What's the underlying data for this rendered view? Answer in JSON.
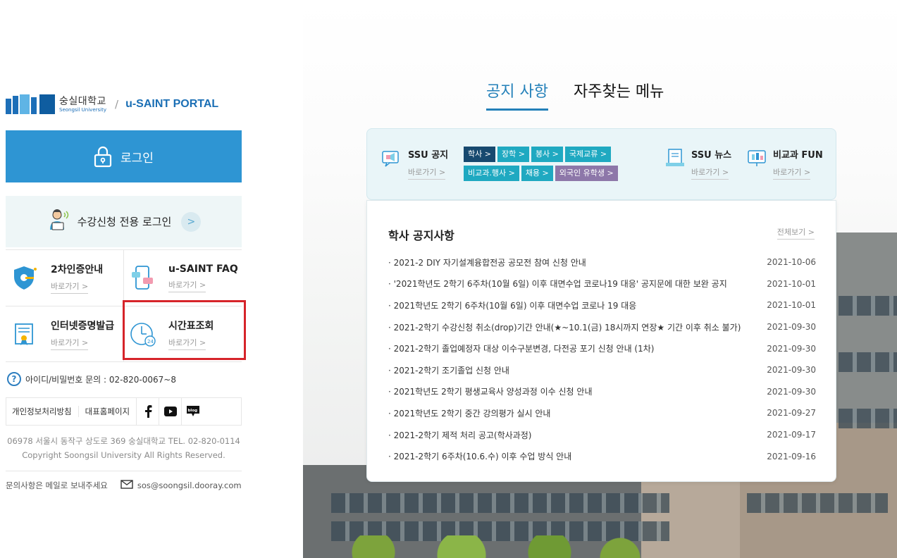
{
  "brand": {
    "logo_ko": "숭실대학교",
    "logo_en": "Seongsil University",
    "separator": "/",
    "portal": "u-SAINT PORTAL"
  },
  "login": {
    "label": "로그인"
  },
  "course_login": {
    "label": "수강신청 전용 로그인",
    "arrow": ">"
  },
  "tiles": [
    {
      "title": "2차인증안내",
      "go": "바로가기 >"
    },
    {
      "title": "u-SAINT FAQ",
      "go": "바로가기 >"
    },
    {
      "title": "인터넷증명발급",
      "go": "바로가기 >"
    },
    {
      "title": "시간표조회",
      "go": "바로가기 >"
    }
  ],
  "inquiry": {
    "icon_text": "?",
    "text": "아이디/비밀번호 문의 : 02-820-0067~8"
  },
  "links": {
    "privacy": "개인정보처리방침",
    "homepage": "대표홈페이지",
    "blog": "blog"
  },
  "footer": {
    "address": "06978 서울시 동작구 상도로 369 숭실대학교 TEL. 02-820-0114",
    "copyright": "Copyright Soongsil University All Rights Reserved.",
    "contact_label": "문의사항은 메일로 보내주세요",
    "email": "sos@soongsil.dooray.com"
  },
  "tabs": {
    "notice": "공지 사항",
    "menu": "자주찾는 메뉴"
  },
  "notice_header": {
    "ssu_title": "SSU 공지",
    "ssu_go": "바로가기 >",
    "categories": [
      "학사 >",
      "장학 >",
      "봉사 >",
      "국제교류 >",
      "비교과.행사 >",
      "채용 >",
      "외국인 유학생 >"
    ],
    "news_title": "SSU 뉴스",
    "news_go": "바로가기 >",
    "fun_title": "비교과 FUN",
    "fun_go": "바로가기 >"
  },
  "notice_body": {
    "title": "학사 공지사항",
    "view_all": "전체보기 >",
    "items": [
      {
        "title": "· 2021-2 DIY 자기설계융합전공 공모전 참여 신청 안내",
        "date": "2021-10-06"
      },
      {
        "title": "· '2021학년도 2학기 6주차(10월 6일) 이후 대면수업 코로나19 대응' 공지문에 대한 보완 공지",
        "date": "2021-10-01"
      },
      {
        "title": "· 2021학년도 2학기 6주차(10월 6일) 이후 대면수업 코로나 19 대응",
        "date": "2021-10-01"
      },
      {
        "title": "· 2021-2학기 수강신청 취소(drop)기간 안내(★~10.1(금) 18시까지 연장★ 기간 이후 취소 불가)",
        "date": "2021-09-30"
      },
      {
        "title": "· 2021-2학기 졸업예정자 대상 이수구분변경, 다전공 포기 신청 안내 (1차)",
        "date": "2021-09-30"
      },
      {
        "title": "· 2021-2학기 조기졸업 신청 안내",
        "date": "2021-09-30"
      },
      {
        "title": "· 2021학년도 2학기 평생교육사 양성과정 이수 신청 안내",
        "date": "2021-09-30"
      },
      {
        "title": "· 2021학년도 2학기 중간 강의평가 실시 안내",
        "date": "2021-09-27"
      },
      {
        "title": "· 2021-2학기 제적 처리 공고(학사과정)",
        "date": "2021-09-17"
      },
      {
        "title": "· 2021-2학기 6주차(10.6.수) 이후 수업 방식 안내",
        "date": "2021-09-16"
      }
    ]
  },
  "colors": {
    "primary": "#2e95d3",
    "brand_blue": "#1b6fb5",
    "tab_active": "#2380b9",
    "highlight_box": "#d6242a",
    "cat_navy": "#17496f",
    "cat_teal": "#1fa9c1",
    "cat_violet": "#8d77a9"
  },
  "icons": [
    "lock-icon",
    "student-pc-icon",
    "shield-key-icon",
    "faq-phone-icon",
    "certificate-icon",
    "clock-24-icon",
    "question-icon",
    "facebook-icon",
    "youtube-icon",
    "blog-icon",
    "mail-icon",
    "megaphone-icon",
    "news-doc-icon",
    "board-icon"
  ]
}
